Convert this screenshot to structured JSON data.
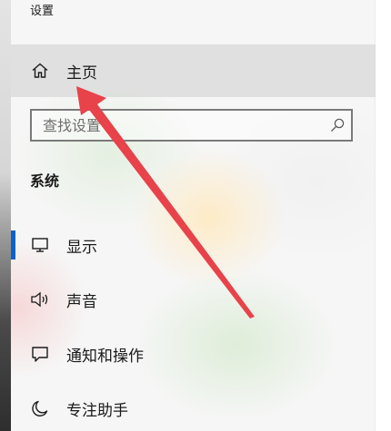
{
  "app": {
    "title": "设置"
  },
  "home": {
    "label": "主页",
    "icon": "home-icon"
  },
  "search": {
    "placeholder": "查找设置",
    "icon": "search-icon"
  },
  "section": {
    "title": "系统"
  },
  "nav_items": [
    {
      "label": "显示",
      "icon": "monitor-icon",
      "selected": true
    },
    {
      "label": "声音",
      "icon": "speaker-icon",
      "selected": false
    },
    {
      "label": "通知和操作",
      "icon": "notification-icon",
      "selected": false
    },
    {
      "label": "专注助手",
      "icon": "moon-icon",
      "selected": false
    }
  ],
  "colors": {
    "accent": "#0a63c9",
    "annotation_arrow": "#e8424a"
  }
}
